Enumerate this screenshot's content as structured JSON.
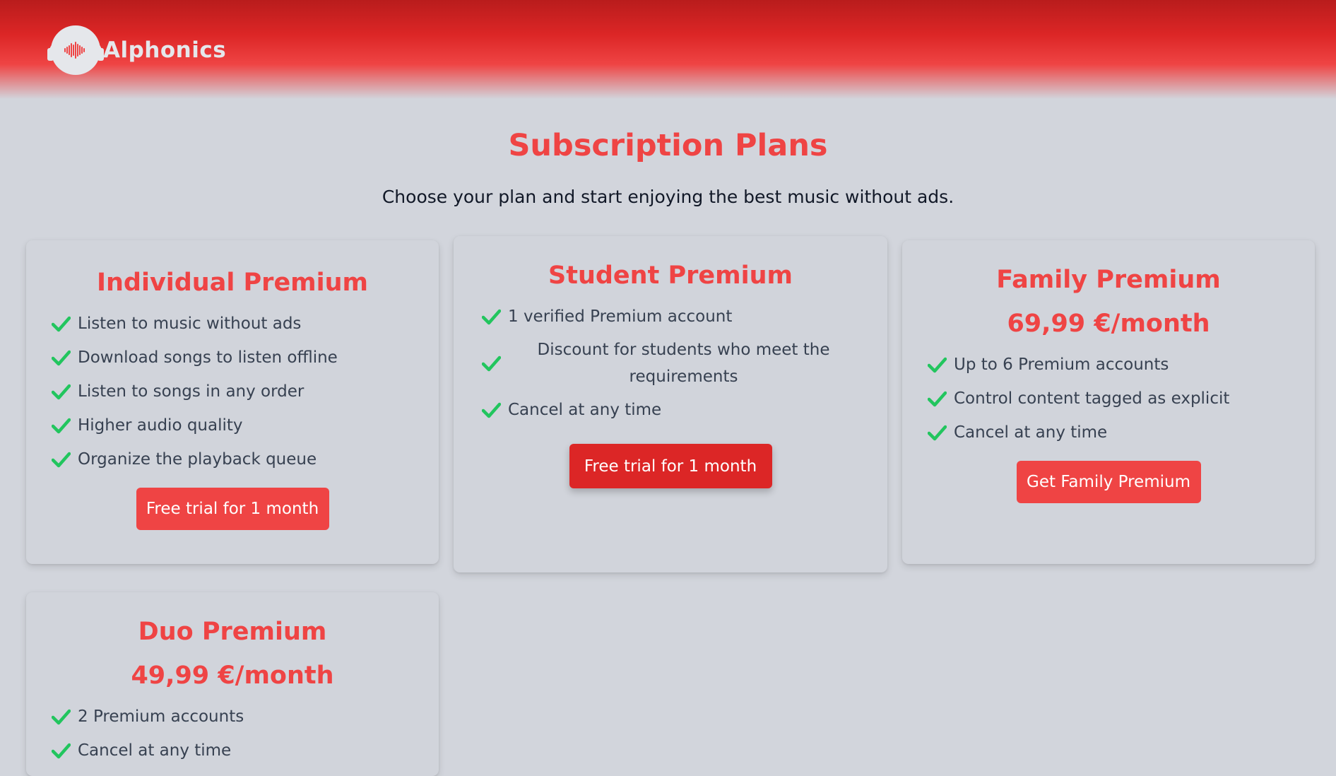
{
  "header": {
    "logo_text": "Alphonics",
    "logo_icon": "headphones-waveform-icon"
  },
  "page": {
    "title": "Subscription Plans",
    "subtitle": "Choose your plan and start enjoying the best music without ads."
  },
  "colors": {
    "accent": "#ef4444",
    "button_primary": "#dc2626",
    "check": "#22c55e",
    "background": "#d2d5dc"
  },
  "plans": [
    {
      "title": "Individual Premium",
      "features": [
        "Listen to music without ads",
        "Download songs to listen offline",
        "Listen to songs in any order",
        "Higher audio quality",
        "Organize the playback queue"
      ],
      "button": "Free trial for 1 month"
    },
    {
      "title": "Student Premium",
      "features": [
        "1 verified Premium account",
        "Discount for students who meet the requirements",
        "Cancel at any time"
      ],
      "button": "Free trial for 1 month"
    },
    {
      "title": "Family Premium",
      "price": "69,99 €/month",
      "features": [
        "Up to 6 Premium accounts",
        "Control content tagged as explicit",
        "Cancel at any time"
      ],
      "button": "Get Family Premium"
    },
    {
      "title": "Duo Premium",
      "price": "49,99 €/month",
      "features": [
        "2 Premium accounts",
        "Cancel at any time"
      ]
    }
  ]
}
